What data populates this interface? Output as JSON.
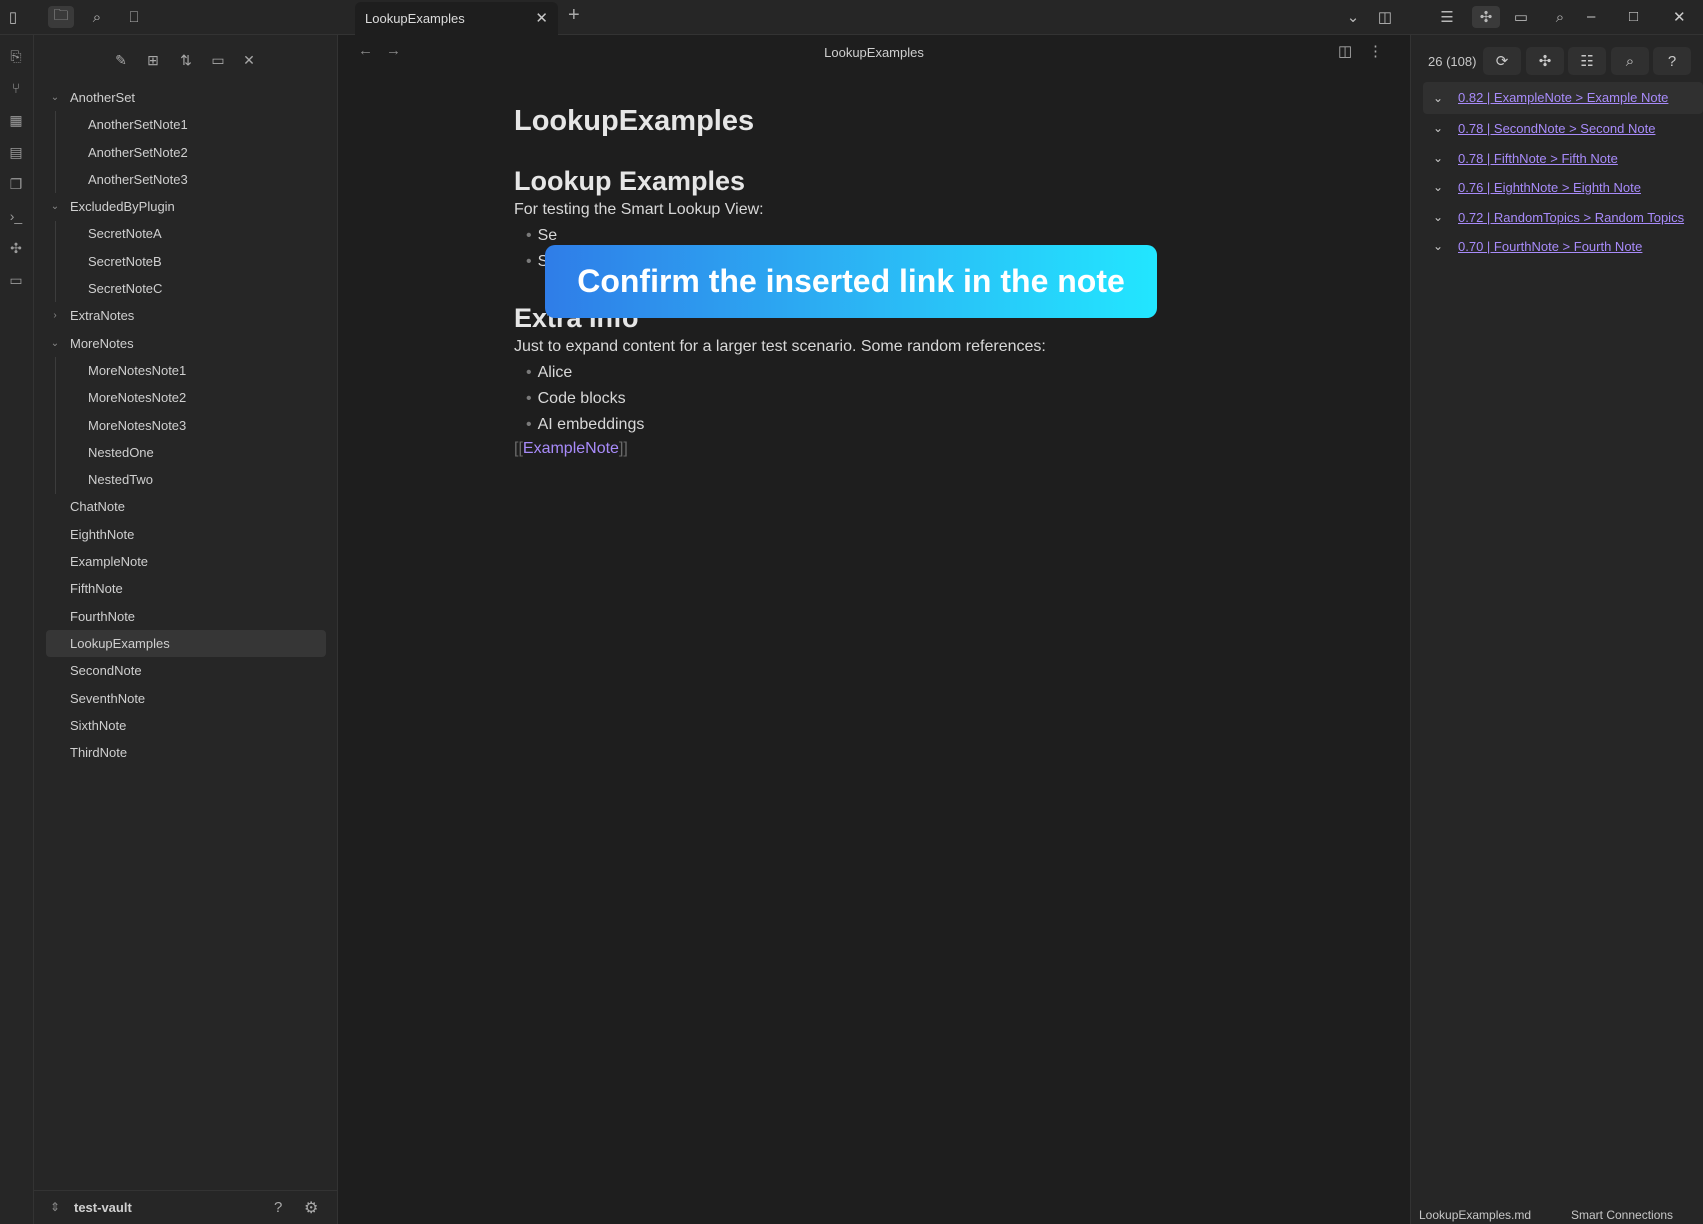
{
  "tab": {
    "title": "LookupExamples"
  },
  "editor": {
    "view_title": "LookupExamples",
    "note_title": "LookupExamples",
    "heading1": "Lookup Examples",
    "intro": "For testing the Smart Lookup View:",
    "intro_bullets": [
      "Se",
      "S"
    ],
    "heading2": "Extra Info",
    "para2": "Just to expand content for a larger test scenario. Some random references:",
    "bullets": [
      "Alice",
      "Code blocks",
      "AI embeddings"
    ],
    "link_open": "[[",
    "link_text": "ExampleNote",
    "link_close": "]]"
  },
  "banner": {
    "text": "Confirm the inserted link in the note"
  },
  "sidebar": {
    "vault_name": "test-vault",
    "tree": [
      {
        "label": "AnotherSet",
        "level": 0,
        "folder": true,
        "open": true
      },
      {
        "label": "AnotherSetNote1",
        "level": 1
      },
      {
        "label": "AnotherSetNote2",
        "level": 1
      },
      {
        "label": "AnotherSetNote3",
        "level": 1
      },
      {
        "label": "ExcludedByPlugin",
        "level": 0,
        "folder": true,
        "open": true
      },
      {
        "label": "SecretNoteA",
        "level": 1
      },
      {
        "label": "SecretNoteB",
        "level": 1
      },
      {
        "label": "SecretNoteC",
        "level": 1
      },
      {
        "label": "ExtraNotes",
        "level": 0,
        "folder": true,
        "open": false
      },
      {
        "label": "MoreNotes",
        "level": 0,
        "folder": true,
        "open": true
      },
      {
        "label": "MoreNotesNote1",
        "level": 1
      },
      {
        "label": "MoreNotesNote2",
        "level": 1
      },
      {
        "label": "MoreNotesNote3",
        "level": 1
      },
      {
        "label": "NestedOne",
        "level": 1
      },
      {
        "label": "NestedTwo",
        "level": 1
      },
      {
        "label": "ChatNote",
        "level": 0
      },
      {
        "label": "EighthNote",
        "level": 0
      },
      {
        "label": "ExampleNote",
        "level": 0
      },
      {
        "label": "FifthNote",
        "level": 0
      },
      {
        "label": "FourthNote",
        "level": 0
      },
      {
        "label": "LookupExamples",
        "level": 0,
        "active": true
      },
      {
        "label": "SecondNote",
        "level": 0
      },
      {
        "label": "SeventhNote",
        "level": 0
      },
      {
        "label": "SixthNote",
        "level": 0
      },
      {
        "label": "ThirdNote",
        "level": 0
      }
    ]
  },
  "rpanel": {
    "count": "26 (108)",
    "results": [
      "0.82 | ExampleNote > Example Note",
      "0.78 | SecondNote > Second Note",
      "0.78 | FifthNote > Fifth Note",
      "0.76 | EighthNote > Eighth Note",
      "0.72 | RandomTopics > Random Topics",
      "0.70 | FourthNote > Fourth Note"
    ],
    "status_file": "LookupExamples.md",
    "status_plugin": "Smart Connections"
  },
  "colors": {
    "accent": "#a88bfa",
    "banner_start": "#2f7de8",
    "banner_end": "#22e6ff"
  }
}
